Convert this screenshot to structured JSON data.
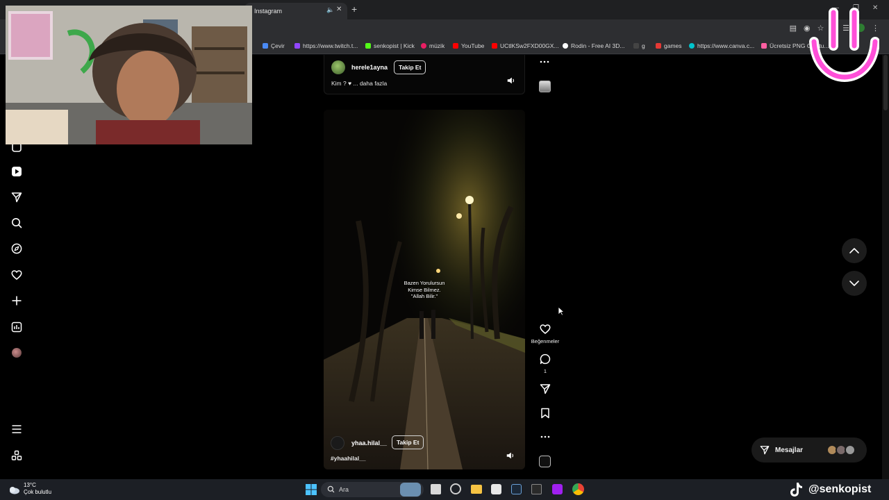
{
  "browser": {
    "tab_title": "Instagram",
    "bookmarks": [
      {
        "label": "Çevir",
        "color": "#4a8af4"
      },
      {
        "label": "https://www.twitch.t...",
        "color": "#9146ff"
      },
      {
        "label": "senkopist | Kick",
        "color": "#53fc18"
      },
      {
        "label": "müzik",
        "color": "#e91e63"
      },
      {
        "label": "YouTube",
        "color": "#ff0000"
      },
      {
        "label": "UCtlKSw2FXD00GX...",
        "color": "#ff0000"
      },
      {
        "label": "Rodin - Free AI 3D...",
        "color": "#ffffff"
      },
      {
        "label": "g",
        "color": "#444444"
      },
      {
        "label": "games",
        "color": "#e53935"
      },
      {
        "label": "https://www.canva.c...",
        "color": "#00c4cc"
      },
      {
        "label": "Ücretsiz PNG Oluştu...",
        "color": "#ff5fa2"
      }
    ]
  },
  "feed": {
    "post1": {
      "username": "herele1ayna",
      "follow_label": "Takip Et",
      "caption": "Kim ? ♥ ... daha fazla"
    },
    "post2": {
      "overlay_lines": [
        "Bazen Yorulursun",
        "Kimse Bilmez.",
        "\"Allah Bilir.\""
      ],
      "username": "yhaa.hilal__",
      "follow_label": "Takip Et",
      "caption": "#yhaahilal__",
      "likes_label": "Beğenmeler",
      "comment_count": "1"
    },
    "messages_label": "Mesajlar"
  },
  "taskbar": {
    "temperature": "13°C",
    "weather": "Çok bulutlu",
    "search_placeholder": "Ara"
  },
  "stream": {
    "tiktok_handle": "@senkopist"
  },
  "colors": {
    "accent_pink": "#ff4fd8",
    "ig_background": "#000000"
  }
}
